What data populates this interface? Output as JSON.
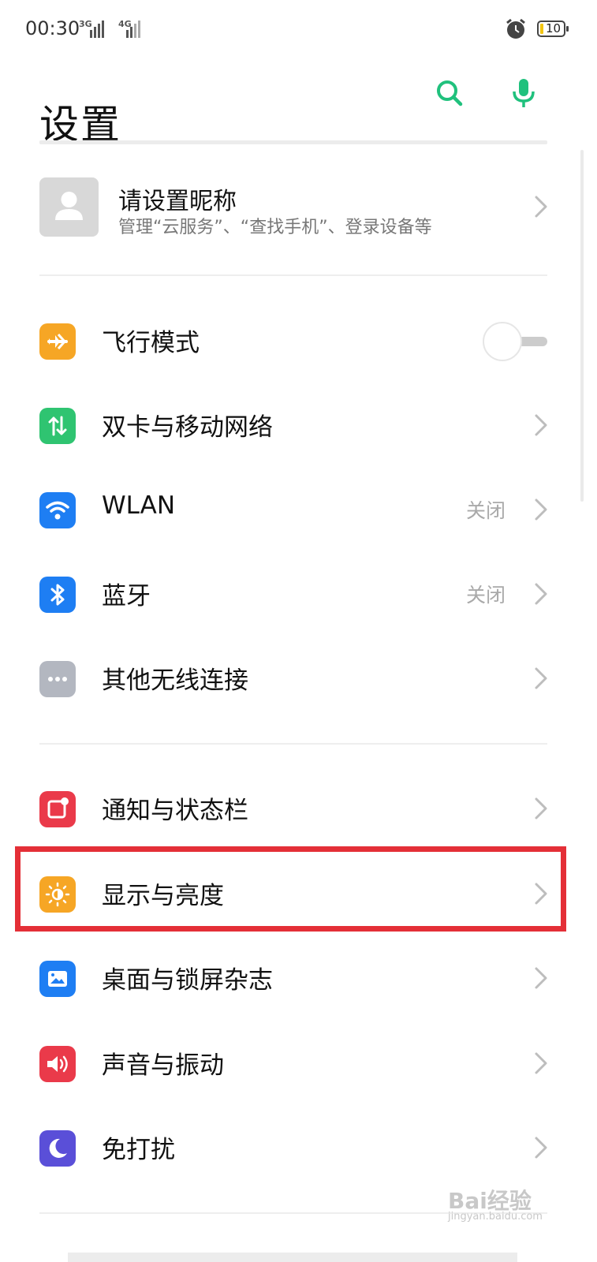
{
  "status_bar": {
    "time": "00:30",
    "signal1_label": "3G",
    "signal2_label": "4G",
    "battery_level": "10"
  },
  "header": {
    "title": "设置",
    "search_icon": "search-icon",
    "mic_icon": "mic-icon",
    "accent_color": "#20c17d"
  },
  "profile": {
    "name": "请设置昵称",
    "subtitle": "管理“云服务”、“查找手机”、登录设备等"
  },
  "settings": {
    "airplane": {
      "label": "飞行模式",
      "icon": "airplane-icon",
      "color": "#f6a625",
      "toggle_on": false
    },
    "dual_sim": {
      "label": "双卡与移动网络",
      "icon": "mobile-data-icon",
      "color": "#2fc471"
    },
    "wlan": {
      "label": "WLAN",
      "value": "关闭",
      "icon": "wifi-icon",
      "color": "#1e7ef3"
    },
    "bluetooth": {
      "label": "蓝牙",
      "value": "关闭",
      "icon": "bluetooth-icon",
      "color": "#1e7ef3"
    },
    "other_wireless": {
      "label": "其他无线连接",
      "icon": "more-icon",
      "color": "#b3b7c0"
    },
    "notifications": {
      "label": "通知与状态栏",
      "icon": "notification-icon",
      "color": "#ea3a4a"
    },
    "display": {
      "label": "显示与亮度",
      "icon": "brightness-icon",
      "color": "#f6a625",
      "highlighted": true
    },
    "wallpaper": {
      "label": "桌面与锁屏杂志",
      "icon": "wallpaper-icon",
      "color": "#1e7ef3"
    },
    "sound": {
      "label": "声音与振动",
      "icon": "speaker-icon",
      "color": "#ea3a4a"
    },
    "dnd": {
      "label": "免打扰",
      "icon": "moon-icon",
      "color": "#5a4fd8"
    }
  },
  "watermark": {
    "text": "Bai经验",
    "sub": "jingyan.baidu.com"
  }
}
